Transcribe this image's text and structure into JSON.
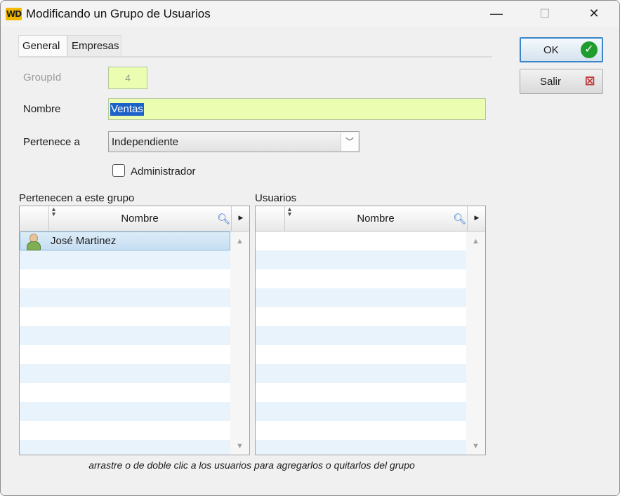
{
  "window": {
    "title": "Modificando un Grupo de Usuarios",
    "logo_text": "WD",
    "minimize": "—",
    "maximize": "☐",
    "close": "✕"
  },
  "tabs": [
    {
      "label": "General"
    },
    {
      "label": "Empresas"
    }
  ],
  "form": {
    "groupid_label": "GroupId",
    "groupid_value": "4",
    "nombre_label": "Nombre",
    "nombre_value": "Ventas",
    "pertenece_label": "Pertenece a",
    "pertenece_value": "Independiente",
    "administrador_label": "Administrador",
    "administrador_checked": false
  },
  "buttons": {
    "ok_label": "OK",
    "salir_label": "Salir"
  },
  "left_table": {
    "caption": "Pertenecen a este grupo",
    "column": "Nombre",
    "rows": [
      {
        "name": "José Martinez"
      }
    ]
  },
  "right_table": {
    "caption": "Usuarios",
    "column": "Nombre",
    "rows": []
  },
  "footer_hint": "arrastre o de doble clic a los usuarios para agregarlos o quitarlos del grupo",
  "colors": {
    "field_bg": "#eafdb0",
    "selection": "#1d62c8",
    "row_alt": "#e9f3fb",
    "ok_icon": "#1f9e2f",
    "cancel_icon": "#c03a3a"
  }
}
